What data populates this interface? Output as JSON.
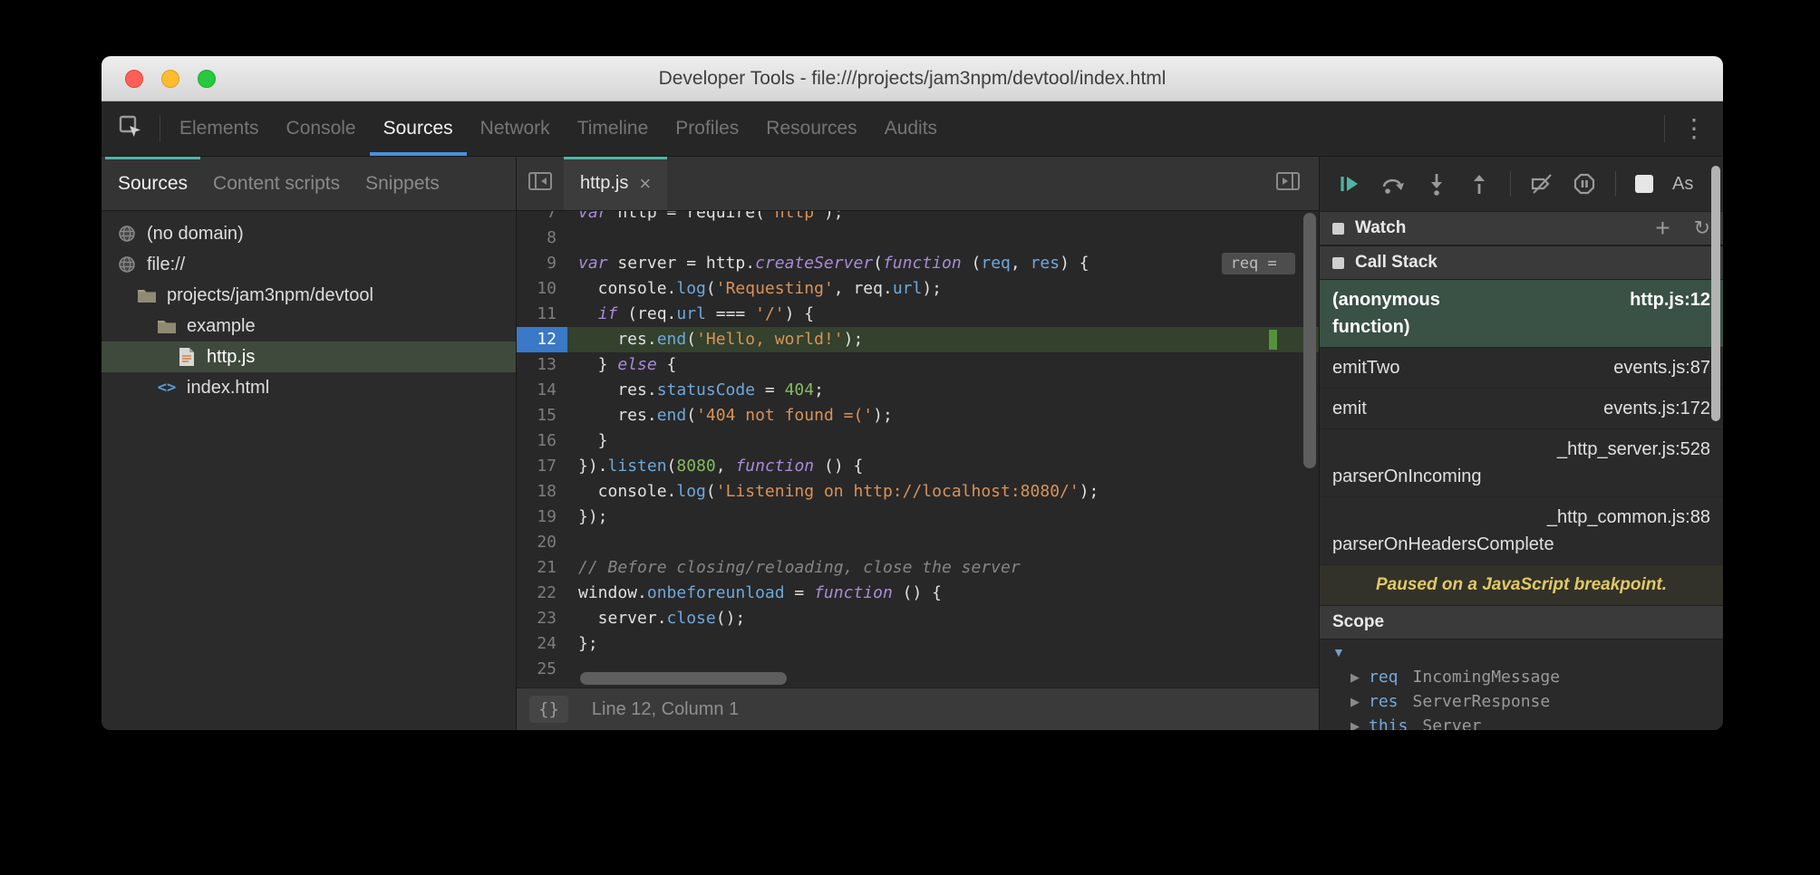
{
  "window": {
    "title": "Developer Tools - file:///projects/jam3npm/devtool/index.html"
  },
  "main_toolbar": {
    "tabs": [
      {
        "label": "Elements",
        "active": false
      },
      {
        "label": "Console",
        "active": false
      },
      {
        "label": "Sources",
        "active": true
      },
      {
        "label": "Network",
        "active": false
      },
      {
        "label": "Timeline",
        "active": false
      },
      {
        "label": "Profiles",
        "active": false
      },
      {
        "label": "Resources",
        "active": false
      },
      {
        "label": "Audits",
        "active": false
      }
    ],
    "more_icon": "⋮"
  },
  "sidebar": {
    "tabs": [
      {
        "label": "Sources",
        "active": true
      },
      {
        "label": "Content scripts",
        "active": false
      },
      {
        "label": "Snippets",
        "active": false
      }
    ],
    "tree": [
      {
        "depth": 0,
        "icon": "domain",
        "label": "(no domain)",
        "selected": false
      },
      {
        "depth": 0,
        "icon": "domain",
        "label": "file://",
        "selected": false
      },
      {
        "depth": 1,
        "icon": "folder",
        "label": "projects/jam3npm/devtool",
        "selected": false
      },
      {
        "depth": 2,
        "icon": "folder",
        "label": "example",
        "selected": false
      },
      {
        "depth": 3,
        "icon": "file-js",
        "label": "http.js",
        "selected": true
      },
      {
        "depth": 2,
        "icon": "file-html",
        "label": "index.html",
        "selected": false
      }
    ]
  },
  "editor": {
    "tab": {
      "label": "http.js",
      "close_icon": "×"
    },
    "active_line": 12,
    "status": {
      "pretty_print": "{}",
      "position": "Line 12, Column 1"
    },
    "lines": [
      {
        "n": 7,
        "tokens": [
          [
            "k",
            "var"
          ],
          [
            "t",
            " http = require("
          ],
          [
            "s",
            "'http'"
          ],
          [
            "t",
            ");"
          ]
        ]
      },
      {
        "n": 8,
        "tokens": []
      },
      {
        "n": 9,
        "hint": "req = ",
        "tokens": [
          [
            "k",
            "var"
          ],
          [
            "t",
            " server = http."
          ],
          [
            "k",
            "createServer"
          ],
          [
            "t",
            "("
          ],
          [
            "k",
            "function"
          ],
          [
            "t",
            " ("
          ],
          [
            "p",
            "req"
          ],
          [
            "t",
            ", "
          ],
          [
            "p",
            "res"
          ],
          [
            "t",
            ") {"
          ]
        ]
      },
      {
        "n": 10,
        "tokens": [
          [
            "t",
            "  console."
          ],
          [
            "p",
            "log"
          ],
          [
            "t",
            "("
          ],
          [
            "s",
            "'Requesting'"
          ],
          [
            "t",
            ", req."
          ],
          [
            "p",
            "url"
          ],
          [
            "t",
            ");"
          ]
        ]
      },
      {
        "n": 11,
        "tokens": [
          [
            "t",
            "  "
          ],
          [
            "k",
            "if"
          ],
          [
            "t",
            " (req."
          ],
          [
            "p",
            "url"
          ],
          [
            "t",
            " === "
          ],
          [
            "s",
            "'/'"
          ],
          [
            "t",
            ") {"
          ]
        ]
      },
      {
        "n": 12,
        "tokens": [
          [
            "t",
            "    res."
          ],
          [
            "p",
            "end"
          ],
          [
            "t",
            "("
          ],
          [
            "s",
            "'Hello, world!'"
          ],
          [
            "t",
            ");"
          ]
        ]
      },
      {
        "n": 13,
        "tokens": [
          [
            "t",
            "  } "
          ],
          [
            "k",
            "else"
          ],
          [
            "t",
            " {"
          ]
        ]
      },
      {
        "n": 14,
        "tokens": [
          [
            "t",
            "    res."
          ],
          [
            "p",
            "statusCode"
          ],
          [
            "t",
            " = "
          ],
          [
            "n",
            "404"
          ],
          [
            "t",
            ";"
          ]
        ]
      },
      {
        "n": 15,
        "tokens": [
          [
            "t",
            "    res."
          ],
          [
            "p",
            "end"
          ],
          [
            "t",
            "("
          ],
          [
            "s",
            "'404 not found =('"
          ],
          [
            "t",
            ");"
          ]
        ]
      },
      {
        "n": 16,
        "tokens": [
          [
            "t",
            "  }"
          ]
        ]
      },
      {
        "n": 17,
        "tokens": [
          [
            "t",
            "})."
          ],
          [
            "p",
            "listen"
          ],
          [
            "t",
            "("
          ],
          [
            "n",
            "8080"
          ],
          [
            "t",
            ", "
          ],
          [
            "k",
            "function"
          ],
          [
            "t",
            " () {"
          ]
        ]
      },
      {
        "n": 18,
        "tokens": [
          [
            "t",
            "  console."
          ],
          [
            "p",
            "log"
          ],
          [
            "t",
            "("
          ],
          [
            "s",
            "'Listening on http://localhost:8080/'"
          ],
          [
            "t",
            ");"
          ]
        ]
      },
      {
        "n": 19,
        "tokens": [
          [
            "t",
            "});"
          ]
        ]
      },
      {
        "n": 20,
        "tokens": []
      },
      {
        "n": 21,
        "tokens": [
          [
            "c",
            "// Before closing/reloading, close the server"
          ]
        ]
      },
      {
        "n": 22,
        "tokens": [
          [
            "t",
            "window."
          ],
          [
            "p",
            "onbeforeunload"
          ],
          [
            "t",
            " = "
          ],
          [
            "k",
            "function"
          ],
          [
            "t",
            " () {"
          ]
        ]
      },
      {
        "n": 23,
        "tokens": [
          [
            "t",
            "  server."
          ],
          [
            "p",
            "close"
          ],
          [
            "t",
            "();"
          ]
        ]
      },
      {
        "n": 24,
        "tokens": [
          [
            "t",
            "};"
          ]
        ]
      },
      {
        "n": 25,
        "tokens": []
      }
    ]
  },
  "debugger": {
    "async_label": "As",
    "watch": {
      "label": "Watch",
      "add_icon": "+",
      "refresh_icon": "↻"
    },
    "call_stack": {
      "label": "Call Stack",
      "frames": [
        {
          "name": "(anonymous function)",
          "loc": "http.js:12",
          "selected": true,
          "wrap": false
        },
        {
          "name": "emitTwo",
          "loc": "events.js:87",
          "selected": false,
          "wrap": false
        },
        {
          "name": "emit",
          "loc": "events.js:172",
          "selected": false,
          "wrap": false
        },
        {
          "name": "parserOnIncoming",
          "loc": "_http_server.js:528",
          "selected": false,
          "wrap": true
        },
        {
          "name": "parserOnHeadersComplete",
          "loc": "_http_common.js:88",
          "selected": false,
          "wrap": true
        }
      ]
    },
    "paused_message": "Paused on a JavaScript breakpoint.",
    "scope": {
      "label": "Scope",
      "expander_icon": "▼",
      "row_icon": "▶",
      "vars": [
        {
          "name": "req",
          "type": "IncomingMessage"
        },
        {
          "name": "res",
          "type": "ServerResponse"
        },
        {
          "name": "this",
          "type": "Server"
        }
      ]
    }
  },
  "colors": {
    "accent_teal": "#4db6a4",
    "accent_blue": "#4a90d9",
    "paused_yellow": "#e3c964"
  }
}
